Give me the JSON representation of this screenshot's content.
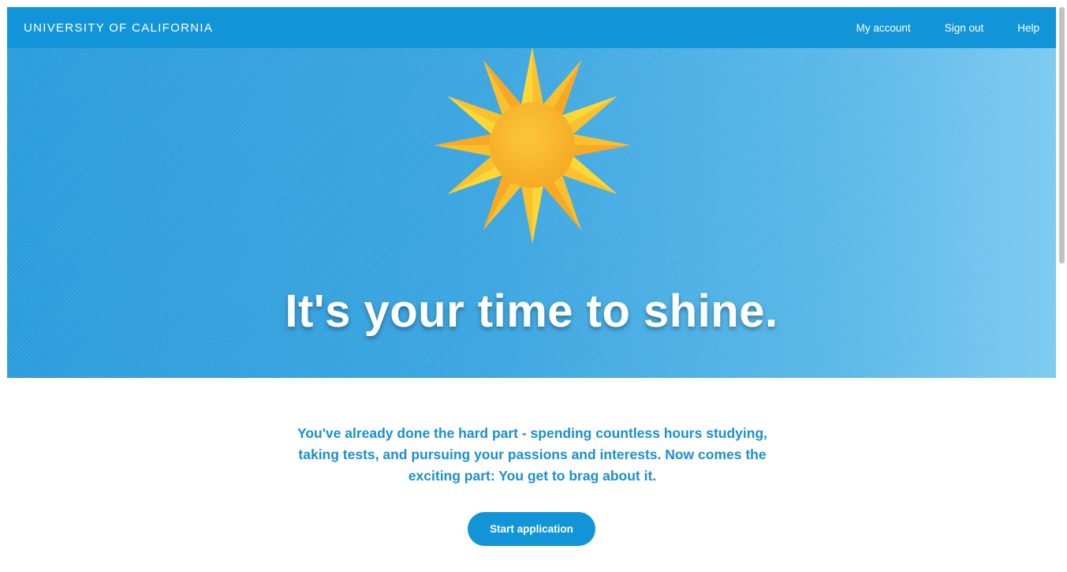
{
  "header": {
    "brand": "UNIVERSITY OF CALIFORNIA",
    "nav": [
      "My account",
      "Sign out",
      "Help"
    ]
  },
  "hero": {
    "title": "It's your time to shine.",
    "icon": "sun-icon"
  },
  "intro": {
    "text": "You've already done the hard part - spending countless hours studying, taking tests, and pursuing your passions and interests. Now comes the exciting part: You get to brag about it."
  },
  "actions": {
    "start_label": "Start application"
  },
  "colors": {
    "brand_blue": "#1295d8",
    "sun_yellow": "#fdd835",
    "sun_core": "#f9b42a"
  }
}
